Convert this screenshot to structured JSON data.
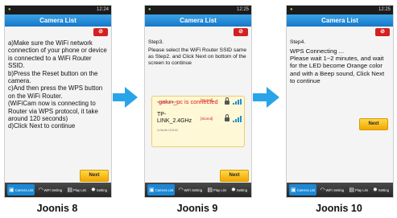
{
  "screens": [
    {
      "status_time": "12:24",
      "title": "Camera List",
      "instructions": "a)Make sure the WiFi network connection of your phone or device is connected to a WiFi Router SSID.\nb)Press the Reset button on the camera.\nc)And then press the WPS button on the WiFi Router.\n(WiFiCam now is connecting to Router via WPS protocol, it take around 120 seconds)\nd)Click Next to continue",
      "next_label": "Next",
      "caption": "Joonis 8"
    },
    {
      "status_time": "12:25",
      "title": "Camera List",
      "step": "Step3.",
      "instructions": "Please select the WiFi Router SSID same as Step2. and Click Next on bottom of the screen to continue",
      "connected_text": "galun_pc is connected",
      "networks": [
        {
          "mac": "ec:08:6f:01:ab:f0",
          "name": "",
          "status": "[Stored]"
        },
        {
          "mac": "1c:5a:6b:13:f1:52",
          "name": "TP-LINK_2.4GHz",
          "status": "[Stored]"
        }
      ],
      "next_label": "Next",
      "caption": "Joonis 9"
    },
    {
      "status_time": "12:25",
      "title": "Camera List",
      "step": "Step4.",
      "instructions": "WPS Connecting ...\nPlease wait 1~2 minutes, and wait for the LED become Orange color and with a Beep sound, Click Next to continue",
      "next_label": "Next",
      "caption": "Joonis 10"
    }
  ],
  "nav": {
    "camera_list": "Camera List",
    "wifi_setting": "WiFi Setting",
    "play_list": "Play List",
    "setting": "Setting"
  },
  "colors": {
    "accent": "#1b88d6",
    "title_bar": "#1677c8",
    "next_button": "#f2a800",
    "alert_red": "#d42020",
    "arrow": "#2aa4e8"
  }
}
